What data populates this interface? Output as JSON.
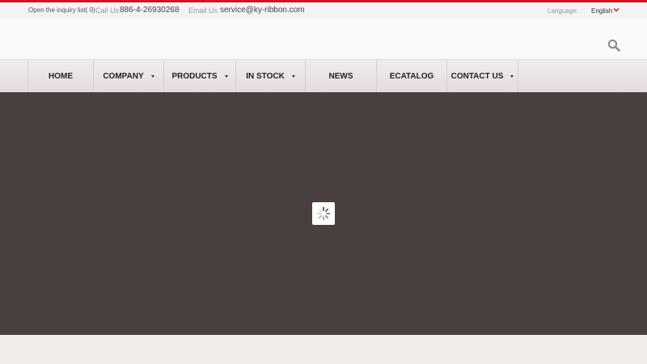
{
  "topbar": {
    "inquiry_label": "Open the inquiry list( 0)",
    "call_label": "Call Us",
    "call_value": "886-4-26930268",
    "email_label": "Email Us",
    "email_value": "service@ky-ribbon.com",
    "language_label": "Language:",
    "language_value": "English",
    "accent_color": "#d6141c"
  },
  "header": {
    "search_icon": "search-icon"
  },
  "nav": {
    "items": [
      {
        "label": "HOME"
      },
      {
        "label": "COMPANY"
      },
      {
        "label": "PRODUCTS"
      },
      {
        "label": "IN STOCK"
      },
      {
        "label": "NEWS"
      },
      {
        "label": "ECATALOG"
      },
      {
        "label": "CONTACT US"
      }
    ]
  },
  "hero": {
    "background_color": "#4a3f3f",
    "loader_icon": "loading-spinner-icon"
  }
}
